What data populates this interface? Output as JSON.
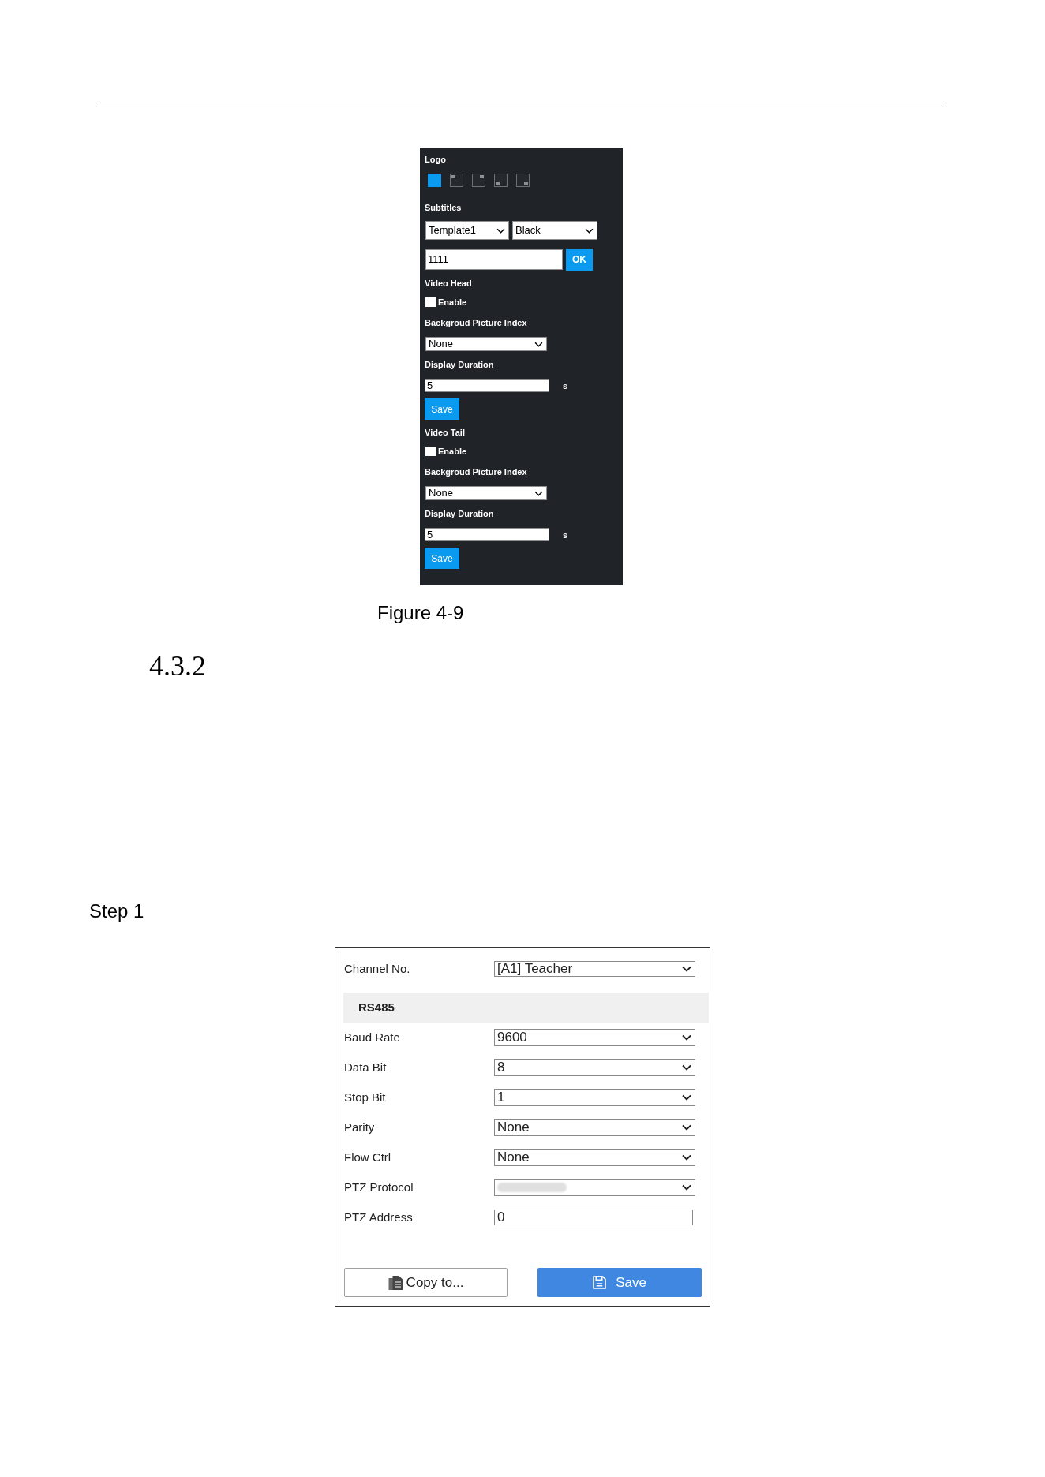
{
  "logo_panel": {
    "logo": {
      "label": "Logo",
      "positions": [
        {
          "kind": "full",
          "selected": true
        },
        {
          "kind": "top-left",
          "selected": false
        },
        {
          "kind": "top-right",
          "selected": false
        },
        {
          "kind": "bottom-left",
          "selected": false
        },
        {
          "kind": "bottom-right",
          "selected": false
        }
      ]
    },
    "subtitles": {
      "label": "Subtitles",
      "template_select": "Template1",
      "color_select": "Black",
      "text": "1111",
      "ok_button": "OK"
    },
    "video_head": {
      "label": "Video Head",
      "enable": {
        "label": "Enable",
        "checked": false
      },
      "background_label": "Backgroud Picture Index",
      "background_select": "None",
      "duration_label": "Display Duration",
      "duration": "5",
      "unit": "s",
      "save_button": "Save"
    },
    "video_tail": {
      "label": "Video Tail",
      "enable": {
        "label": "Enable",
        "checked": false
      },
      "background_label": "Backgroud Picture Index",
      "background_select": "None",
      "duration_label": "Display Duration",
      "duration": "5",
      "unit": "s",
      "save_button": "Save"
    }
  },
  "figure_caption": "Figure 4-9",
  "section_number": "4.3.2",
  "step_label": "Step 1",
  "serial_panel": {
    "channel": {
      "label": "Channel No.",
      "value": "[A1] Teacher"
    },
    "section": "RS485",
    "fields": [
      {
        "kind": "select",
        "label": "Baud Rate",
        "value": "9600",
        "blurred": false
      },
      {
        "kind": "select",
        "label": "Data Bit",
        "value": "8",
        "blurred": false
      },
      {
        "kind": "select",
        "label": "Stop Bit",
        "value": "1",
        "blurred": false
      },
      {
        "kind": "select",
        "label": "Parity",
        "value": "None",
        "blurred": false
      },
      {
        "kind": "select",
        "label": "Flow Ctrl",
        "value": "None",
        "blurred": false
      },
      {
        "kind": "select",
        "label": "PTZ Protocol",
        "blurred": true
      },
      {
        "kind": "input",
        "label": "PTZ Address",
        "value": "0",
        "blurred": false
      }
    ],
    "buttons": [
      {
        "kind": "copy",
        "label": "Copy to..."
      },
      {
        "kind": "save",
        "label": "Save"
      }
    ]
  }
}
